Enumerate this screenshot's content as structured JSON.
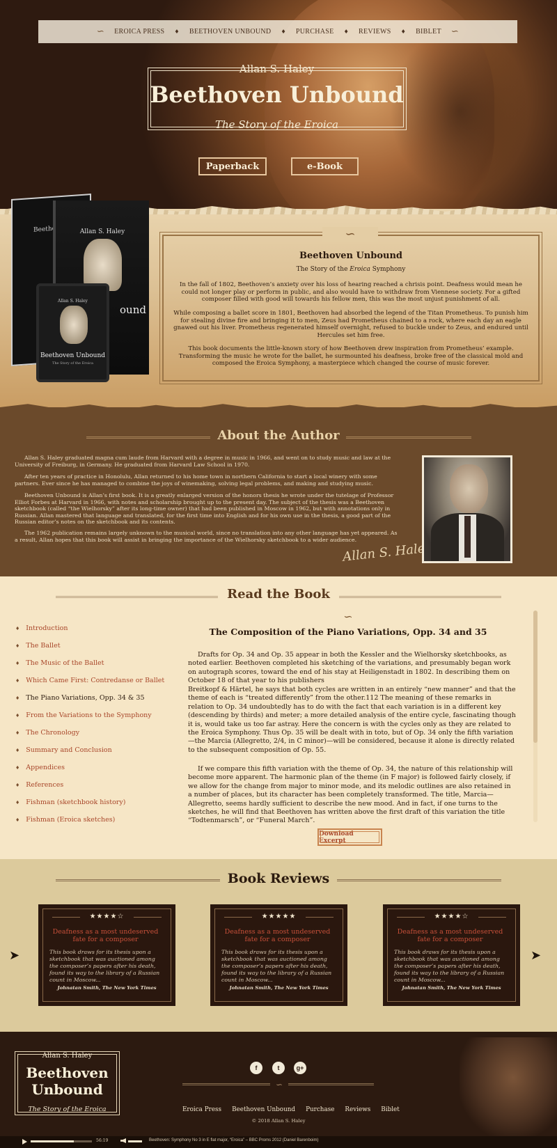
{
  "nav": {
    "items": [
      "EROICA PRESS",
      "BEETHOVEN UNBOUND",
      "PURCHASE",
      "REVIEWS",
      "BIBLET"
    ]
  },
  "hero": {
    "author": "Allan S. Haley",
    "title": "Beethoven Unbound",
    "subtitle": "The Story of the Eroica",
    "buttons": [
      "Paperback",
      "e-Book"
    ]
  },
  "book": {
    "cover_author": "Allan S. Haley",
    "cover_title": "Beethoven Unbound",
    "cover_sub": "The Story of the Eroica",
    "back_title": "Beethov",
    "back_title_end": "ound",
    "title": "Beethoven Unbound",
    "subtitle_pre": "The Story of the ",
    "subtitle_em": "Eroica",
    "subtitle_post": " Symphony",
    "paragraphs": [
      "In the fall of 1802, Beethoven’s anxiety over his loss of hearing reached a chrisis point. Deafness would mean he could not longer play or perform in public, and also would have to withdraw from Viennese society. For a gifted composer filled with good will towards his fellow men, this was the most unjust punishment of all.",
      "While composing a ballet score in 1801, Beethoven had absorbed the legend of the Titan Prometheus. To punish him for stealing divine fire and bringing it to men, Zeus had Prometheus chained to a rock, where each day an eagle gnawed out his liver. Prometheus regenerated himself overnight, refused to buckle under to Zeus, and endured until Hercules set him free.",
      "This book documents the little-known story of how Beethoven drew inspiration from Prometheus’ example. Transforming the music he wrote for the ballet, he surmounted his deafness, broke free of the classical mold and composed the Eroica Symphony, a masterpiece which changed the course of music forever."
    ]
  },
  "about": {
    "heading": "About the Author",
    "paragraphs": [
      "Allan S. Haley graduated magna cum laude from Harvard with a degree in music in 1966, and went on to study music and law at the University of Freiburg, in Germany.  He graduated from Harvard Law School in 1970.",
      "After ten years of practice in Honolulu, Allan returned to his home town in northern California to start a local winery with some partners. Ever since he has managed to combine the joys of winemaking, solving legal problems, and making and studying music.",
      "Beethoven Unbound is Allan’s first book. It is a greatly enlarged version of the honors thesis he wrote under the tutelage of Professor Elliot Forbes at Harvard in 1966, with notes and scholarship brought up to the present day.  The subject of the thesis was a Beethoven sketchbook (called “the Wielhorsky” after its long-time owner) that had been published in Moscow in 1962, but with annotations only in Russian. Allan mastered that language and translated, for the first time into English and for his own use in the thesis, a good part of the Russian editor’s notes on the sketchbook and its contents.",
      "The 1962 publication remains largely unknown to the musical world, since no translation into any other language has yet appeared. As a result, Allan hopes that this book will assist in bringing the importance of the Wielhorsky sketchbook to a wider audience."
    ],
    "signature": "Allan S. Haley"
  },
  "read": {
    "heading": "Read the Book",
    "toc": [
      "Introduction",
      "The Ballet",
      "The Music of the Ballet",
      "Which Came First: Contredanse or Ballet",
      "The Piano Variations, Opp. 34 & 35",
      "From the Variations to the Symphony",
      "The Chronology",
      "Summary and Conclusion",
      "Appendices",
      "References",
      "Fishman (sketchbook history)",
      "Fishman (Eroica sketches)"
    ],
    "chapter_title": "The Composition of the Piano Variations, Opp. 34 and 35",
    "paragraphs": [
      "Drafts for Op. 34 and Op. 35 appear in both the Kessler and the Wielhorsky sketchbooks, as noted earlier. Beethoven completed his sketching of the variations, and presumably began work on autograph scores, toward the end of his stay at Heiligenstadt in 1802. In describing them on October 18 of that year to his publishers",
      "Breitkopf & Härtel, he says that both cycles are written in an entirely “new manner” and that the theme of each is “treated differently” from the other.112 The meaning of these remarks in relation to Op. 34 undoubtedly has to do with the fact that each variation is in a different key (descending by thirds) and meter; a more detailed analysis of the entire cycle, fascinating though it is, would take us too far astray. Here the concern is with the cycles only as they are related to the Eroica Symphony. Thus Op. 35 will be dealt with in toto, but of Op. 34 only the fifth variation—the Marcia (Allegretto, 2/4, in C minor)—will be considered, because it alone is directly related to the subsequent composition of Op. 55.",
      "If we compare this fifth variation with the theme of Op. 34, the nature of this relationship will become more apparent. The harmonic plan of the theme (in F major) is followed fairly closely, if we allow for the change from major to minor mode, and its melodic outlines are also retained in a number of places, but its character has been completely transformed. The title, Marcia—Allegretto, seems hardly sufficient to describe the new mood. And in fact, if one turns to the sketches, he will find that Beethoven has written above the first draft of this variation the title “Todtenmarsch”, or “Funeral March”."
    ],
    "download": "Download Excerpt"
  },
  "reviews": {
    "heading": "Book Reviews",
    "items": [
      {
        "stars": "★★★★☆",
        "title": "Deafness as a most undeserved fate for a composer",
        "body": "This book draws for its thesis upon a sketchbook that was auctioned among the composer’s papers after his death, found its way to the library of a Russian count in Moscow...",
        "source": "Johnatan Smith, The New York Times"
      },
      {
        "stars": "★★★★★",
        "title": "Deafness as a most undeserved fate for a composer",
        "body": "This book draws for its thesis upon a sketchbook that was auctioned among the composer’s papers after his death, found its way to the library of a Russian count in Moscow...",
        "source": "Johnatan Smith, The New York Times"
      },
      {
        "stars": "★★★★☆",
        "title": "Deafness as a most undeserved fate for a composer",
        "body": "This book draws for its thesis upon a sketchbook that was auctioned among the composer’s papers after his death, found its way to the library of a Russian count in Moscow...",
        "source": "Johnatan Smith, The New York Times"
      }
    ]
  },
  "footer": {
    "author": "Allan S. Haley",
    "title_line1": "Beethoven",
    "title_line2": "Unbound",
    "subtitle": "The Story of the Eroica",
    "social": [
      "f",
      "t",
      "g+"
    ],
    "nav": [
      "Eroica Press",
      "Beethoven Unbound",
      "Purchase",
      "Reviews",
      "Biblet"
    ],
    "copyright": "© 2018 Allan S. Haley"
  },
  "player": {
    "time": "56:19",
    "progress": 0.7,
    "song": "Beethoven: Symphony No 3 in E flat major, “Eroica” – BBC Proms 2012 (Daniel Barenboim)"
  }
}
